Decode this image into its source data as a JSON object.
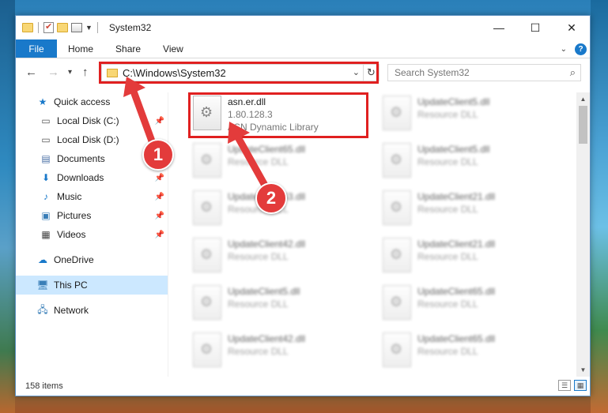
{
  "window": {
    "title": "System32",
    "controls": {
      "minimize": "—",
      "maximize": "☐",
      "close": "✕"
    }
  },
  "ribbon": {
    "tabs": [
      "File",
      "Home",
      "Share",
      "View"
    ]
  },
  "address": {
    "path": "C:\\Windows\\System32",
    "search_placeholder": "Search System32"
  },
  "nav": {
    "quick_access": "Quick access",
    "items": [
      {
        "label": "Local Disk (C:)",
        "icon": "drive-icon",
        "pinned": true
      },
      {
        "label": "Local Disk (D:)",
        "icon": "drive-icon",
        "pinned": false
      },
      {
        "label": "Documents",
        "icon": "documents-icon",
        "pinned": true
      },
      {
        "label": "Downloads",
        "icon": "downloads-icon",
        "pinned": true
      },
      {
        "label": "Music",
        "icon": "music-icon",
        "pinned": true
      },
      {
        "label": "Pictures",
        "icon": "pictures-icon",
        "pinned": true
      },
      {
        "label": "Videos",
        "icon": "videos-icon",
        "pinned": true
      }
    ],
    "onedrive": "OneDrive",
    "this_pc": "This PC",
    "network": "Network"
  },
  "files": {
    "target": {
      "name": "asn.er.dll",
      "version": "1.80.128.3",
      "description": "ASN Dynamic Library"
    },
    "left_column": [
      {
        "name": "UpdateClient65.dll",
        "type": "Resource DLL"
      },
      {
        "name": "UpdateClient63.dll",
        "type": "Resource DLL"
      },
      {
        "name": "UpdateClient42.dll",
        "type": "Resource DLL"
      },
      {
        "name": "UpdateClient5.dll",
        "type": "Resource DLL"
      },
      {
        "name": "UpdateClient42.dll",
        "type": "Resource DLL"
      }
    ],
    "right_column": [
      {
        "name": "UpdateClient5.dll",
        "type": "Resource DLL"
      },
      {
        "name": "UpdateClient5.dll",
        "type": "Resource DLL"
      },
      {
        "name": "UpdateClient21.dll",
        "type": "Resource DLL"
      },
      {
        "name": "UpdateClient21.dll",
        "type": "Resource DLL"
      },
      {
        "name": "UpdateClient65.dll",
        "type": "Resource DLL"
      },
      {
        "name": "UpdateClient65.dll",
        "type": "Resource DLL"
      }
    ]
  },
  "status": {
    "item_count": "158 items"
  },
  "annotations": {
    "step1": "1",
    "step2": "2",
    "color": "#e33b3b"
  }
}
